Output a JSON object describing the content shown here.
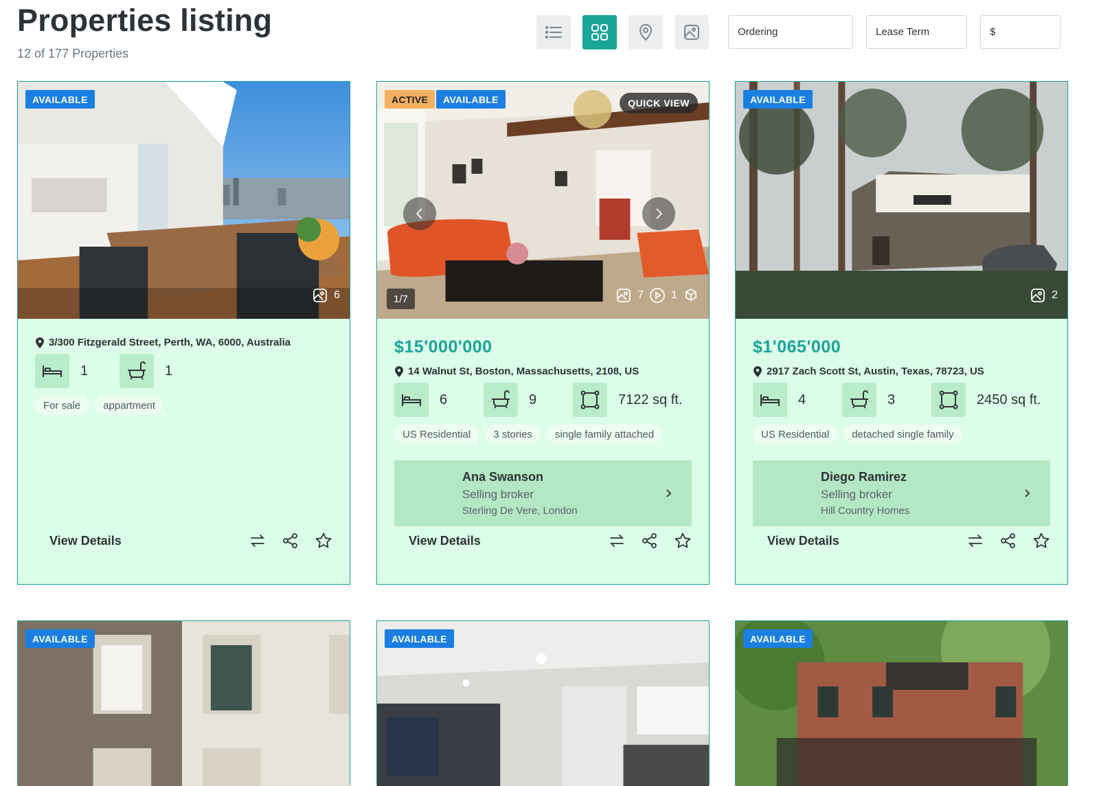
{
  "header": {
    "title": "Properties listing",
    "count": "12 of 177 Properties",
    "view_modes": [
      "list-view",
      "grid-view",
      "map-view",
      "gallery-view"
    ],
    "active_view": "grid-view",
    "ordering_label": "Ordering",
    "lease_term_label": "Lease Term",
    "currency_label": "$"
  },
  "colors": {
    "accent": "#1aa598",
    "card_bg": "#dcfde8",
    "available_badge": "#1a7fe0",
    "active_badge": "#f2b060"
  },
  "cards": [
    {
      "badges": [
        "AVAILABLE"
      ],
      "photo_count": "6",
      "address": "3/300 Fitzgerald Street, Perth, WA, 6000, Australia",
      "beds": "1",
      "baths": "1",
      "tags": [
        "For sale",
        "appartment"
      ],
      "view_details": "View Details"
    },
    {
      "badges": [
        "ACTIVE",
        "AVAILABLE"
      ],
      "quick_view": "QUICK VIEW",
      "pager": "1/7",
      "photo_count": "7",
      "video_count": "1",
      "price": "$15'000'000",
      "address": "14 Walnut St, Boston, Massachusetts, 2108, US",
      "beds": "6",
      "baths": "9",
      "area": "7122 sq ft.",
      "tags": [
        "US Residential",
        "3 stories",
        "single family attached"
      ],
      "broker": {
        "name": "Ana Swanson",
        "role": "Selling broker",
        "agency": "Sterling De Vere, London"
      },
      "view_details": "View Details"
    },
    {
      "badges": [
        "AVAILABLE"
      ],
      "photo_count": "2",
      "price": "$1'065'000",
      "address": "2917 Zach Scott St, Austin, Texas, 78723, US",
      "beds": "4",
      "baths": "3",
      "area": "2450 sq ft.",
      "tags": [
        "US Residential",
        "detached single family"
      ],
      "broker": {
        "name": "Diego Ramirez",
        "role": "Selling broker",
        "agency": "Hill Country Homes"
      },
      "view_details": "View Details"
    },
    {
      "badges": [
        "AVAILABLE"
      ]
    },
    {
      "badges": [
        "AVAILABLE"
      ]
    },
    {
      "badges": [
        "AVAILABLE"
      ]
    }
  ],
  "icons": {
    "photo": "image-icon",
    "video": "play-icon",
    "tour": "3d-tour-icon",
    "bed": "bed-icon",
    "bath": "bath-icon",
    "area": "area-icon",
    "compare": "compare-icon",
    "share": "share-icon",
    "favorite": "star-icon",
    "location": "location-pin-icon"
  }
}
